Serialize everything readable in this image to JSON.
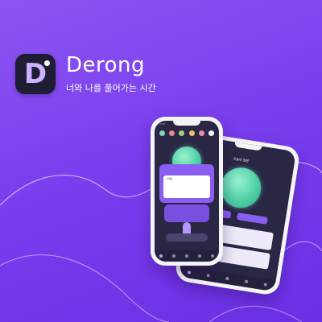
{
  "app": {
    "name": "Derong",
    "icon_letter": "D",
    "tagline": "너와 나를 풀어가는 시간"
  },
  "colors": {
    "background": "#7a3fee",
    "icon_bg": "#1f1d33",
    "screen_bg": "#2a2745",
    "accent_purple": "#8a5ef0",
    "planet_green": "#4fd0a6"
  },
  "phone_front": {
    "status_time": "2:30",
    "profile_label": "닉네임"
  },
  "phone_back": {
    "header_title": "오늘의 질문"
  }
}
